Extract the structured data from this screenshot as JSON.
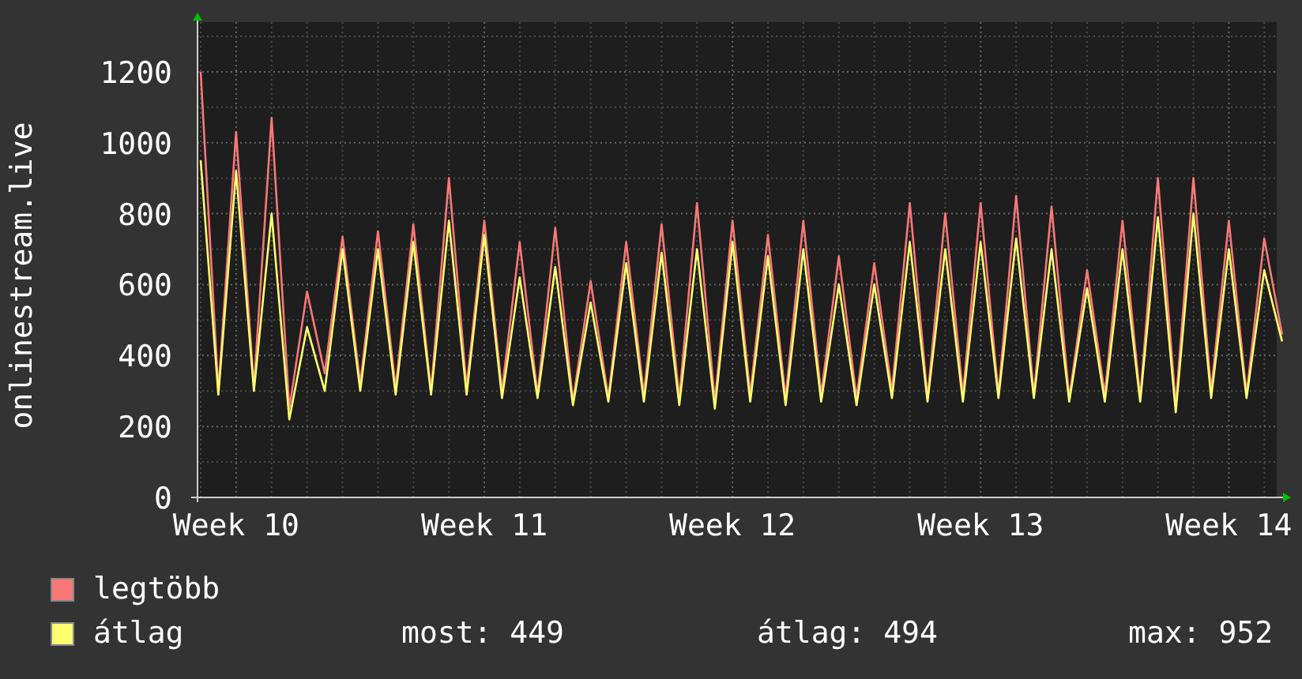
{
  "graph": {
    "chart_data": {
      "type": "line",
      "ylabel": "onlinestream.live",
      "categories": [
        null,
        null,
        "Week 10",
        null,
        null,
        null,
        null,
        null,
        null,
        null,
        null,
        null,
        null,
        null,
        null,
        null,
        "Week 11",
        null,
        null,
        null,
        null,
        null,
        null,
        null,
        null,
        null,
        null,
        null,
        null,
        null,
        "Week 12",
        null,
        null,
        null,
        null,
        null,
        null,
        null,
        null,
        null,
        null,
        null,
        null,
        null,
        "Week 13",
        null,
        null,
        null,
        null,
        null,
        null,
        null,
        null,
        null,
        null,
        null,
        null,
        null,
        "Week 14",
        null,
        null,
        null
      ],
      "series": [
        {
          "name": "legtöbb",
          "color": "#f87878",
          "values": [
            1200,
            300,
            1030,
            310,
            1070,
            250,
            580,
            350,
            735,
            320,
            750,
            310,
            770,
            300,
            900,
            310,
            780,
            300,
            720,
            290,
            760,
            270,
            610,
            280,
            720,
            290,
            770,
            280,
            830,
            270,
            780,
            290,
            740,
            280,
            780,
            290,
            680,
            280,
            660,
            300,
            830,
            280,
            800,
            290,
            830,
            290,
            850,
            290,
            820,
            280,
            640,
            290,
            780,
            280,
            900,
            260,
            900,
            300,
            780,
            290,
            730,
            460
          ]
        },
        {
          "name": "átlag",
          "color": "#ffff70",
          "values": [
            950,
            290,
            920,
            300,
            800,
            220,
            480,
            300,
            700,
            300,
            700,
            290,
            720,
            290,
            780,
            290,
            740,
            280,
            620,
            280,
            650,
            260,
            550,
            270,
            660,
            270,
            690,
            260,
            700,
            250,
            720,
            270,
            680,
            260,
            700,
            270,
            600,
            260,
            600,
            280,
            720,
            270,
            700,
            270,
            720,
            280,
            730,
            280,
            700,
            270,
            590,
            270,
            700,
            270,
            790,
            240,
            800,
            280,
            700,
            280,
            640,
            440
          ]
        }
      ],
      "grid": true,
      "ylim": [
        0,
        1340
      ],
      "yticks": [
        0,
        200,
        400,
        600,
        800,
        1000,
        1200
      ]
    }
  },
  "stats": [
    "most: 449",
    "átlag: 494",
    "max: 952"
  ]
}
